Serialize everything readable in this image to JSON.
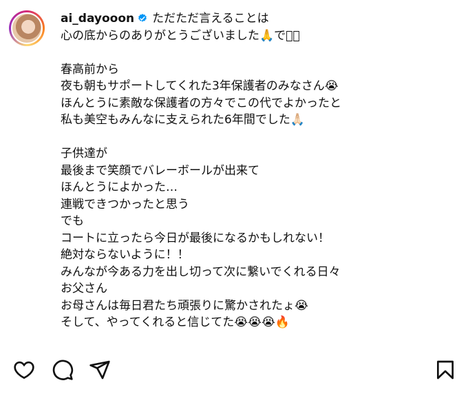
{
  "post": {
    "username": "ai_dayooon",
    "verified_icon": "verified-badge-icon",
    "caption_lines": [
      "ただただ言えることは",
      "心の底からのありがとうございました🙏です🏻",
      "",
      "春高前から",
      "夜も朝もサポートしてくれた3年保護者のみなさん😭",
      "ほんとうに素敵な保護者の方々でこの代でよかったと",
      "私も美空もみんなに支えられた6年間でした🙏🏻",
      "",
      "子供達が",
      "最後まで笑顔でバレーボールが出来て",
      "ほんとうによかった…",
      "連戦できつかったと思う",
      "でも",
      "コートに立ったら今日が最後になるかもしれない！",
      "絶対ならないように！！",
      "みんなが今ある力を出し切って次に繋いでくれる日々",
      "お父さん",
      "お母さんは毎日君たち頑張りに驚かされたょ😭",
      "そして、やってくれると信じてた😭😭😭🔥"
    ]
  },
  "actions": {
    "like_icon": "heart-icon",
    "comment_icon": "comment-icon",
    "share_icon": "paper-plane-icon",
    "save_icon": "bookmark-icon"
  },
  "colors": {
    "background": "#ffffff",
    "text": "#111111",
    "verified": "#0095f6"
  }
}
